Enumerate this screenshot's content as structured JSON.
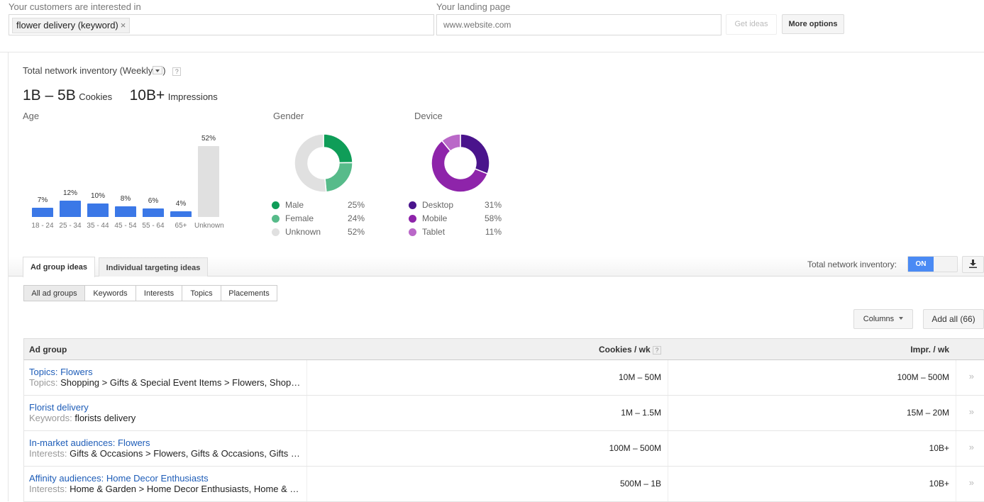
{
  "search": {
    "interest_label": "Your customers are interested in",
    "interest_chip": "flower delivery (keyword)",
    "chip_remove": "×",
    "landing_label": "Your landing page",
    "landing_placeholder": "www.website.com",
    "get_ideas": "Get ideas",
    "more_options": "More options"
  },
  "summary": {
    "title_prefix": "Total network inventory (Weekly",
    "title_suffix": ")",
    "help": "?",
    "cookies_value": "1B – 5B",
    "cookies_label": "Cookies",
    "impressions_value": "10B+",
    "impressions_label": "Impressions"
  },
  "chart_data": [
    {
      "type": "bar",
      "title": "Age",
      "categories": [
        "18 - 24",
        "25 - 34",
        "35 - 44",
        "45 - 54",
        "55 - 64",
        "65+",
        "Unknown"
      ],
      "values": [
        7,
        12,
        10,
        8,
        6,
        4,
        52
      ],
      "data_labels": [
        "7%",
        "12%",
        "10%",
        "8%",
        "6%",
        "4%",
        "52%"
      ],
      "colors": [
        "#3b78e7",
        "#3b78e7",
        "#3b78e7",
        "#3b78e7",
        "#3b78e7",
        "#3b78e7",
        "#e0e0e0"
      ],
      "ylim": [
        0,
        52
      ],
      "grid": false
    },
    {
      "type": "pie",
      "title": "Gender",
      "categories": [
        "Male",
        "Female",
        "Unknown"
      ],
      "values": [
        25,
        24,
        52
      ],
      "labels": [
        "25%",
        "24%",
        "52%"
      ],
      "colors": [
        "#0f9d58",
        "#57bb8a",
        "#e0e0e0"
      ],
      "legend": "bottom"
    },
    {
      "type": "pie",
      "title": "Device",
      "categories": [
        "Desktop",
        "Mobile",
        "Tablet"
      ],
      "values": [
        31,
        58,
        11
      ],
      "labels": [
        "31%",
        "58%",
        "11%"
      ],
      "colors": [
        "#4a148c",
        "#8e24aa",
        "#ba68c8"
      ],
      "legend": "bottom"
    }
  ],
  "tabs": [
    {
      "label": "Ad group ideas",
      "active": true
    },
    {
      "label": "Individual targeting ideas",
      "active": false
    }
  ],
  "filters": [
    {
      "label": "All ad groups",
      "active": true
    },
    {
      "label": "Keywords",
      "active": false
    },
    {
      "label": "Interests",
      "active": false
    },
    {
      "label": "Topics",
      "active": false
    },
    {
      "label": "Placements",
      "active": false
    }
  ],
  "toolbar": {
    "inventory_label": "Total network inventory:",
    "toggle_state": "ON",
    "download_icon": "download-icon",
    "columns": "Columns",
    "add_all": "Add all (66)"
  },
  "table": {
    "headers": {
      "ad_group": "Ad group",
      "cookies": "Cookies / wk",
      "cookies_help": "?",
      "impr": "Impr. / wk"
    },
    "rows": [
      {
        "name": "Topics: Flowers",
        "prefix": "Topics:",
        "desc": "Shopping > Gifts & Special Event Items > Flowers, Shop…",
        "cookies": "10M – 50M",
        "impr": "100M – 500M",
        "arrow": "»"
      },
      {
        "name": "Florist delivery",
        "prefix": "Keywords:",
        "desc": "florists delivery",
        "cookies": "1M – 1.5M",
        "impr": "15M – 20M",
        "arrow": "»"
      },
      {
        "name": "In-market audiences: Flowers",
        "prefix": "Interests:",
        "desc": "Gifts & Occasions > Flowers, Gifts & Occasions, Gifts …",
        "cookies": "100M – 500M",
        "impr": "10B+",
        "arrow": "»"
      },
      {
        "name": "Affinity audiences: Home Decor Enthusiasts",
        "prefix": "Interests:",
        "desc": "Home & Garden > Home Decor Enthusiasts, Home & …",
        "cookies": "500M – 1B",
        "impr": "10B+",
        "arrow": "»"
      }
    ]
  }
}
